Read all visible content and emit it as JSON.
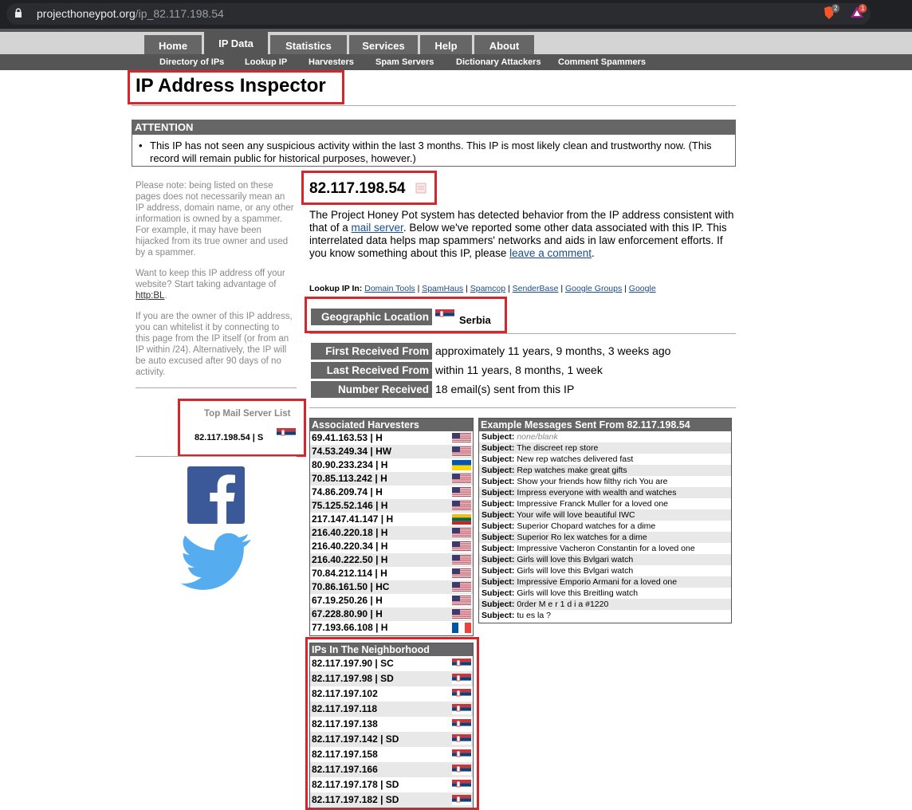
{
  "browser": {
    "url_host": "projecthoneypot.org",
    "url_path": "/ip_82.117.198.54",
    "ext1_badge": "2",
    "ext2_badge": "1"
  },
  "nav": {
    "tabs": [
      "Home",
      "IP Data",
      "Statistics",
      "Services",
      "Help",
      "About"
    ],
    "subs": [
      "Directory of IPs",
      "Lookup IP",
      "Harvesters",
      "Spam Servers",
      "Dictionary Attackers",
      "Comment Spammers"
    ]
  },
  "page": {
    "title": "IP Address Inspector"
  },
  "attention": {
    "header": "ATTENTION",
    "text": "This IP has not seen any suspicious activity within the last 3 months. This IP is most likely clean and trustworthy now. (This record will remain public for historical purposes, however.)"
  },
  "sidebar": {
    "note1": "Please note: being listed on these pages does not necessarily mean an IP address, domain name, or any other information is owned by a spammer. For example, it may have been hijacked from its true owner and used by a spammer.",
    "note2_pre": "Want to keep this IP address off your website? Start taking advantage of ",
    "note2_link": "http:BL",
    "note2_post": ".",
    "note3": "If you are the owner of this IP address, you can whitelist it by connecting to this page from the IP itself (or from an IP within /24). Alternatively, the IP will be auto excused after 90 days of no activity.",
    "top_list_title": "Top Mail Server List",
    "top_list_entry": "82.117.198.54 | S"
  },
  "main": {
    "ip": "82.117.198.54",
    "para_1": "The Project Honey Pot system has detected behavior from the IP address consistent with that of a ",
    "para_link1": "mail server",
    "para_2": ". Below we've reported some other data associated with this IP. This interrelated data helps map spammers' networks and aids in law enforcement efforts. If you know something about this IP, please ",
    "para_link2": "leave a comment",
    "para_3": ".",
    "lookup_label": "Lookup IP In:",
    "lookup_links": [
      "Domain Tools",
      "SpamHaus",
      "Spamcop",
      "SenderBase",
      "Google Groups",
      "Google"
    ],
    "geo_label": "Geographic Location",
    "geo_value": "Serbia",
    "first_label": "First Received From",
    "first_value": "approximately 11 years, 9 months, 3 weeks ago",
    "last_label": "Last Received From",
    "last_value": "within 11 years, 8 months, 1 week",
    "number_label": "Number Received",
    "number_value": "18 email(s) sent from this IP"
  },
  "harvesters": {
    "title": "Associated Harvesters",
    "rows": [
      {
        "text": "69.41.163.53 | H",
        "flag": "us"
      },
      {
        "text": "74.53.249.34 | HW",
        "flag": "us"
      },
      {
        "text": "80.90.233.234 | H",
        "flag": "ua"
      },
      {
        "text": "70.85.113.242 | H",
        "flag": "us"
      },
      {
        "text": "74.86.209.74 | H",
        "flag": "us"
      },
      {
        "text": "75.125.52.146 | H",
        "flag": "us"
      },
      {
        "text": "217.147.41.147 | H",
        "flag": "lt"
      },
      {
        "text": "216.40.220.18 | H",
        "flag": "us"
      },
      {
        "text": "216.40.220.34 | H",
        "flag": "us"
      },
      {
        "text": "216.40.222.50 | H",
        "flag": "us"
      },
      {
        "text": "70.84.212.114 | H",
        "flag": "us"
      },
      {
        "text": "70.86.161.50 | HC",
        "flag": "us"
      },
      {
        "text": "67.19.250.26 | H",
        "flag": "us"
      },
      {
        "text": "67.228.80.90 | H",
        "flag": "us"
      },
      {
        "text": "77.193.66.108 | H",
        "flag": "fr"
      }
    ]
  },
  "messages": {
    "title": "Example Messages Sent From 82.117.198.54",
    "label": "Subject:",
    "rows": [
      "none/blank",
      "The discreet rep store",
      "New rep watches delivered fast",
      "Rep watches make great gifts",
      "Show your friends how filthy rich You are",
      "Impress everyone with wealth and watches",
      "Impressive Franck Muller for a loved one",
      "Your wife will love beautiful IWC",
      "Superior Chopard watches for a dime",
      "Superior Ro lex watches for a dime",
      "Impressive Vacheron Constantin for a loved one",
      "Girls will love this Bvlgari watch",
      "Girls will love this Bvlgari watch",
      "Impressive Emporio Armani for a loved one",
      "Girls will love this Breitling watch",
      "0rder M e r 1 d i a #1220",
      "tu es la ?"
    ]
  },
  "neighborhood": {
    "title": "IPs In The Neighborhood",
    "rows": [
      "82.117.197.90 | SC",
      "82.117.197.98 | SD",
      "82.117.197.102",
      "82.117.197.118",
      "82.117.197.138",
      "82.117.197.142 | SD",
      "82.117.197.158",
      "82.117.197.166",
      "82.117.197.178 | SD",
      "82.117.197.182 | SD"
    ]
  },
  "colors": {
    "highlight": "#d8242b",
    "header_gray": "#666666",
    "facebook": "#3b5998",
    "twitter": "#55acee"
  }
}
